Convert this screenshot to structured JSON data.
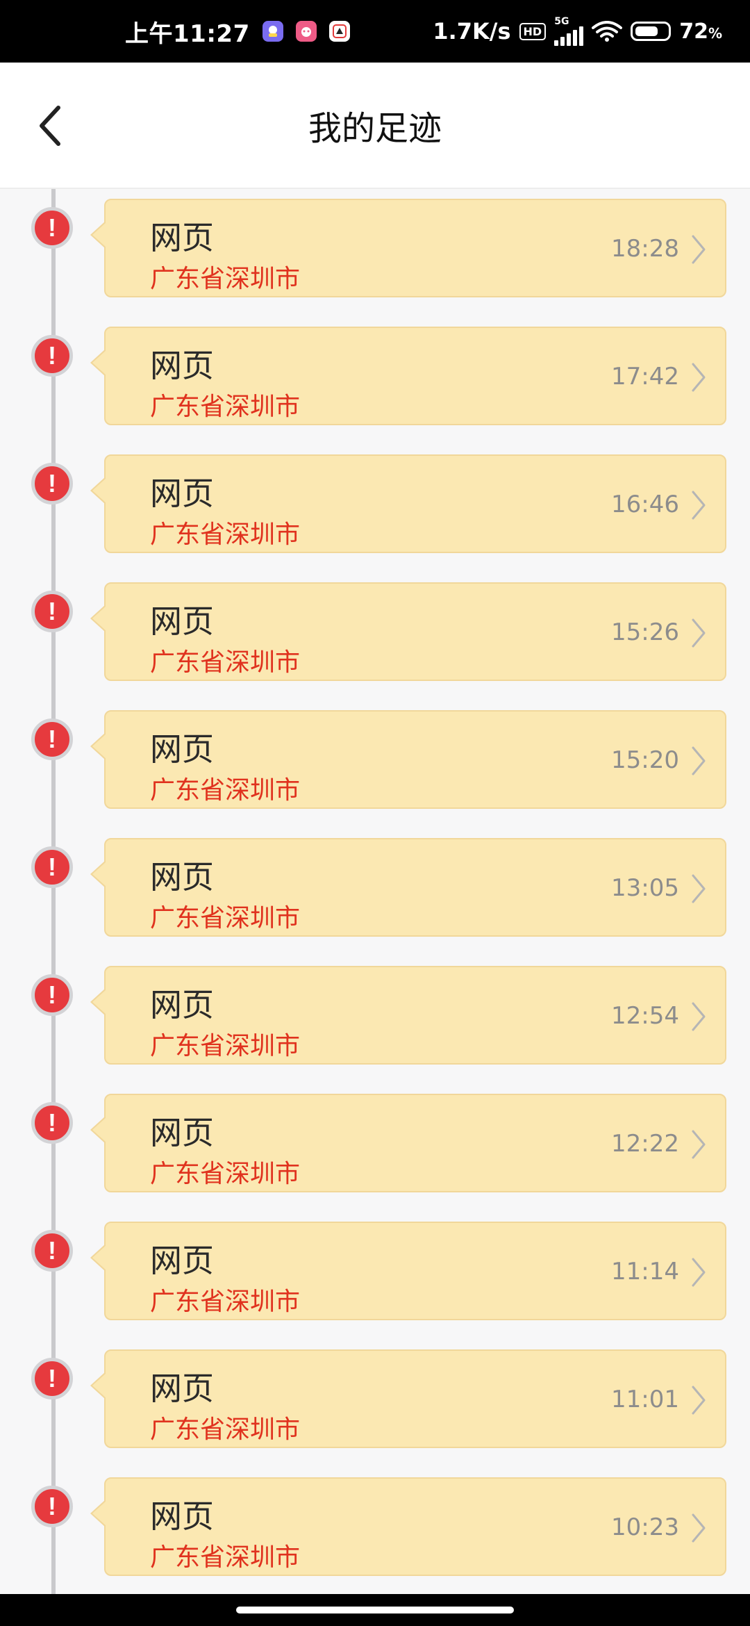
{
  "status_bar": {
    "time": "上午11:27",
    "net_speed": "1.7K/s",
    "hd_label": "HD",
    "network_type": "5G",
    "battery_number": "72",
    "battery_unit": "%",
    "battery_level": 0.72,
    "notification_icons": [
      "app-notification-icon-1",
      "app-notification-icon-2",
      "app-notification-icon-3"
    ]
  },
  "header": {
    "title": "我的足迹",
    "back_icon": "chevron-left-icon"
  },
  "colors": {
    "card_bg": "#fbe8b2",
    "marker_red": "#e63a3e",
    "location_red": "#e0321e",
    "time_gray": "#8c8c8c"
  },
  "items": [
    {
      "title": "网页",
      "location": "广东省深圳市",
      "time": "18:28"
    },
    {
      "title": "网页",
      "location": "广东省深圳市",
      "time": "17:42"
    },
    {
      "title": "网页",
      "location": "广东省深圳市",
      "time": "16:46"
    },
    {
      "title": "网页",
      "location": "广东省深圳市",
      "time": "15:26"
    },
    {
      "title": "网页",
      "location": "广东省深圳市",
      "time": "15:20"
    },
    {
      "title": "网页",
      "location": "广东省深圳市",
      "time": "13:05"
    },
    {
      "title": "网页",
      "location": "广东省深圳市",
      "time": "12:54"
    },
    {
      "title": "网页",
      "location": "广东省深圳市",
      "time": "12:22"
    },
    {
      "title": "网页",
      "location": "广东省深圳市",
      "time": "11:14"
    },
    {
      "title": "网页",
      "location": "广东省深圳市",
      "time": "11:01"
    },
    {
      "title": "网页",
      "location": "广东省深圳市",
      "time": "10:23"
    }
  ],
  "marker_symbol": "!"
}
